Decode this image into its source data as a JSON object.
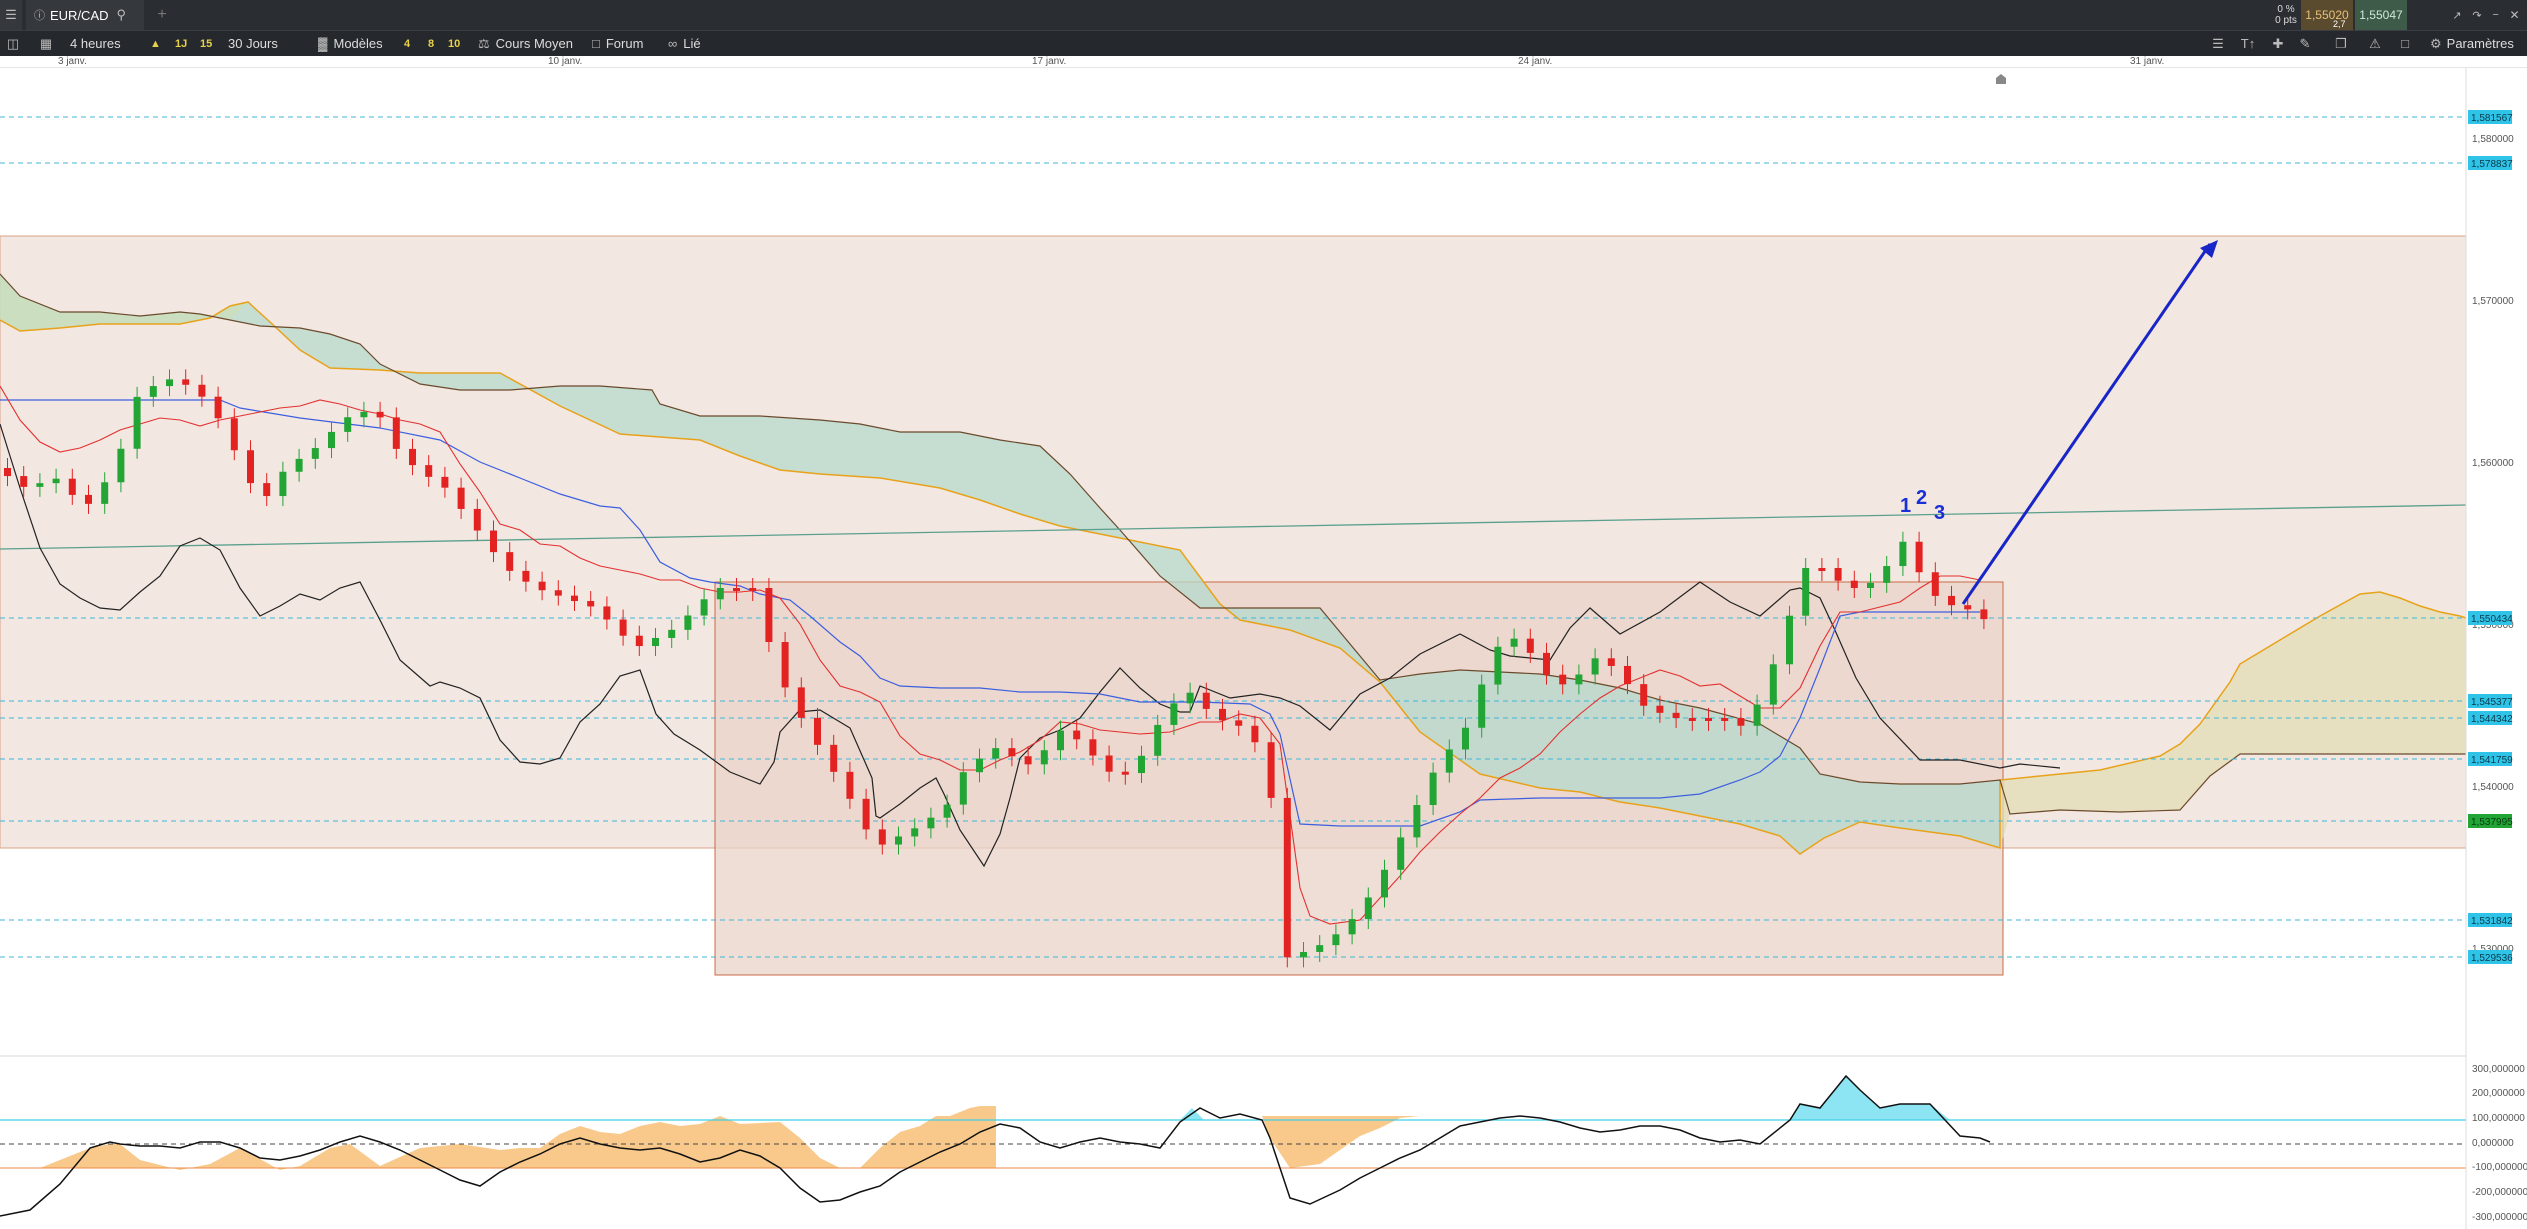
{
  "topbar": {
    "instrument": "EUR/CAD",
    "change_pct": "0 %",
    "change_pts": "0 pts",
    "bid": "1,55020",
    "ask": "1,55047",
    "spread": "2,7"
  },
  "toolbar": {
    "timeframe": "4 heures",
    "period_buttons": [
      "1J",
      "15"
    ],
    "period": "30 Jours",
    "models_label": "Modèles",
    "model_buttons": [
      "4",
      "8",
      "10"
    ],
    "average_label": "Cours Moyen",
    "forum_label": "Forum",
    "linked_label": "Lié",
    "settings_label": "Paramètres"
  },
  "time_axis": [
    "3 janv.",
    "10 janv.",
    "17 janv.",
    "24 janv.",
    "31 janv."
  ],
  "price_axis": [
    "1,580000",
    "1,570000",
    "1,560000",
    "1,550000",
    "1,540000",
    "1,530000"
  ],
  "price_tags": [
    "1,581567",
    "1,578837",
    "1,550434",
    "1,545377",
    "1,544342",
    "1,541759",
    "1,537995",
    "1,531842",
    "1,529536"
  ],
  "indicator_axis": [
    "300,000000",
    "200,000000",
    "100,000000",
    "0,000000",
    "-100,000000",
    "-200,000000",
    "-300,000000"
  ],
  "annotations": [
    "1",
    "2",
    "3"
  ],
  "colors": {
    "bull": "#22a535",
    "bear": "#e32222",
    "tenkan": "#e33030",
    "kijun": "#3c5fe0",
    "cloud_bull": "#b7d9cc",
    "cloud_bear": "#efe0b8",
    "zone": "#f2e3dc",
    "arrow": "#1826c8",
    "tag": "#2fc3e8"
  }
}
